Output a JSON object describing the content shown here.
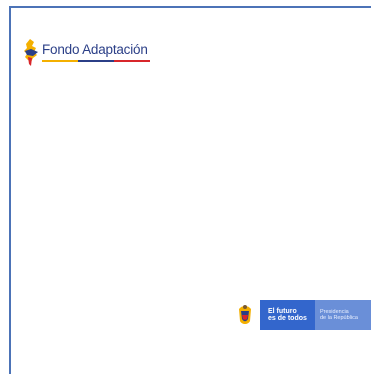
{
  "brand": {
    "name": "Fondo Adaptación"
  },
  "footer": {
    "slogan_line1": "El futuro",
    "slogan_line2": "es de todos",
    "presidency_line1": "Presidencia",
    "presidency_line2": "de la República"
  },
  "colors": {
    "frame": "#4c73b7",
    "brand_text": "#2b3f87",
    "accent_yellow": "#f4b000",
    "accent_red": "#d8262b",
    "gov_blue": "#3366cc",
    "gov_blue_light": "#6a8fd8"
  }
}
